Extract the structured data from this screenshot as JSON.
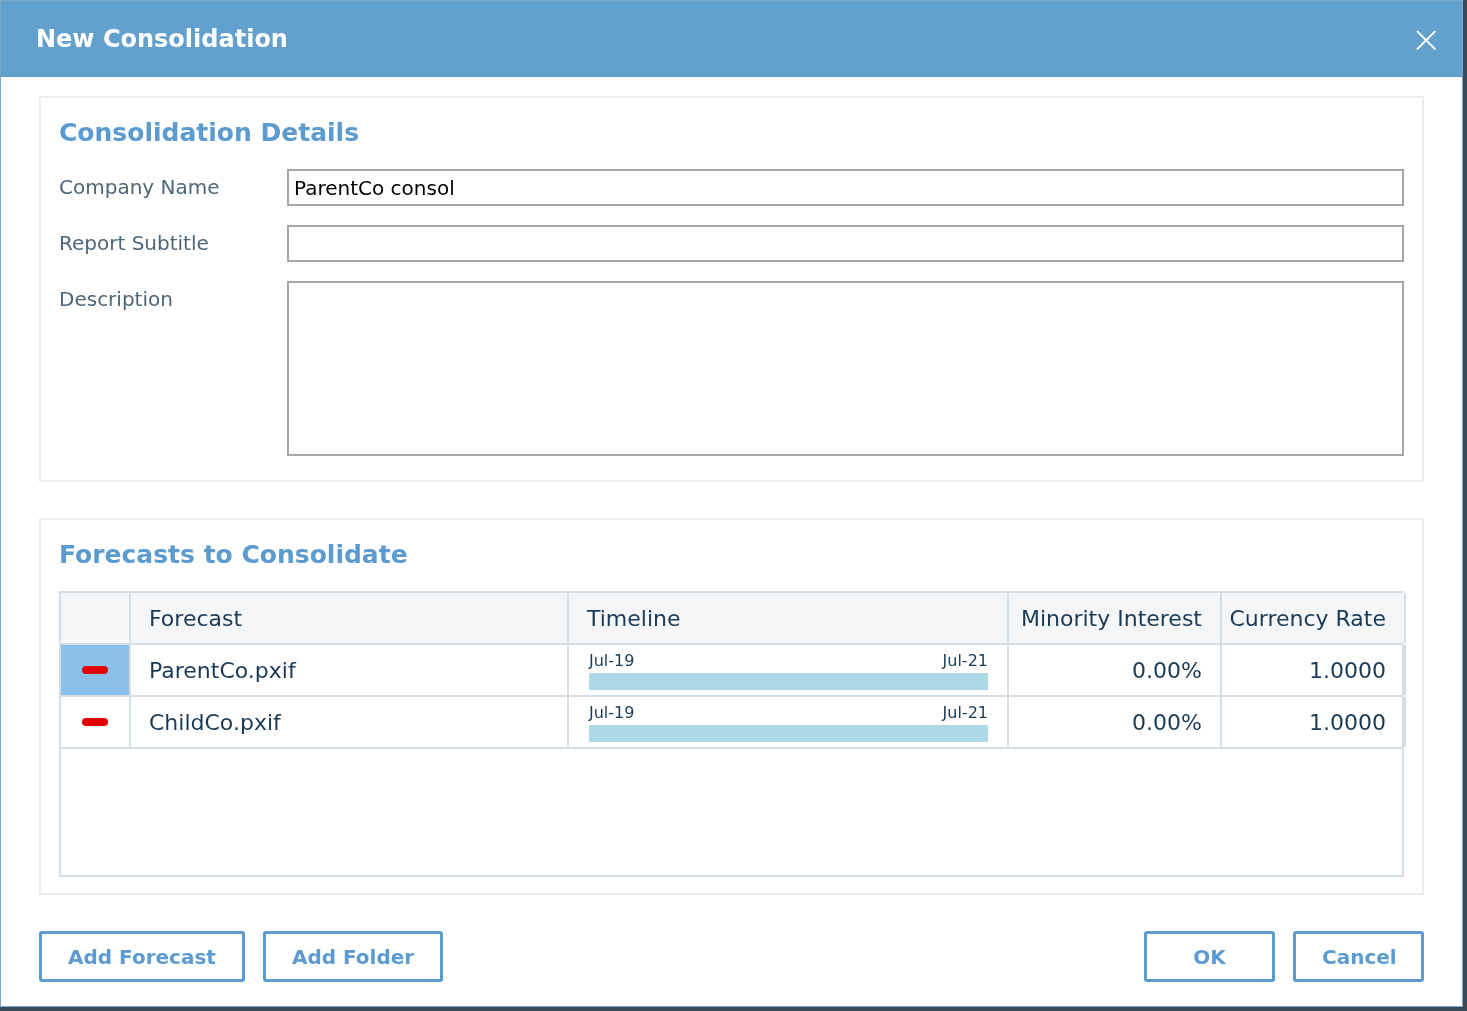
{
  "window": {
    "title": "New Consolidation",
    "close": "×"
  },
  "details": {
    "heading": "Consolidation Details",
    "fields": [
      {
        "label": "Company Name",
        "value": "ParentCo consol",
        "kind": "line"
      },
      {
        "label": "Report Subtitle",
        "kind": "line"
      },
      {
        "label": "Description",
        "kind": "area"
      }
    ]
  },
  "forecasts": {
    "heading": "Forecasts to Consolidate",
    "columns": [
      "Forecast",
      "Timeline",
      "Minority Interest",
      "Currency Rate"
    ],
    "rows": [
      {
        "selected": true,
        "forecast": "ParentCo.pxif",
        "start": "Jul-19",
        "end": "Jul-21",
        "minority_interest": "0.00%",
        "currency_rate": "1.0000"
      },
      {
        "selected": false,
        "forecast": "ChildCo.pxif",
        "start": "Jul-19",
        "end": "Jul-21",
        "minority_interest": "0.00%",
        "currency_rate": "1.0000"
      }
    ]
  },
  "buttons_left": [
    "Add Forecast",
    "Add Folder"
  ],
  "buttons_right": [
    "OK",
    "Cancel"
  ]
}
